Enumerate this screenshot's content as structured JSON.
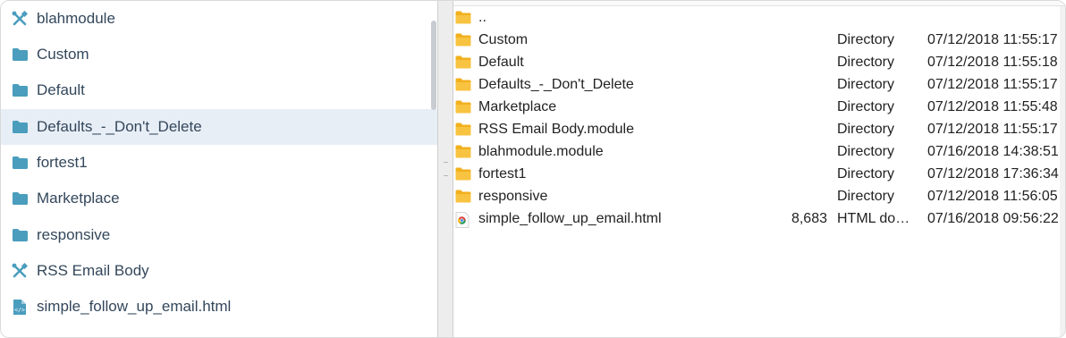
{
  "left_panel": {
    "items": [
      {
        "label": "blahmodule",
        "icon": "module-tools-icon"
      },
      {
        "label": "Custom",
        "icon": "folder-icon"
      },
      {
        "label": "Default",
        "icon": "folder-icon"
      },
      {
        "label": "Defaults_-_Don't_Delete",
        "icon": "folder-icon",
        "selected": true
      },
      {
        "label": "fortest1",
        "icon": "folder-icon"
      },
      {
        "label": "Marketplace",
        "icon": "folder-icon"
      },
      {
        "label": "responsive",
        "icon": "folder-icon"
      },
      {
        "label": "RSS Email Body",
        "icon": "module-tools-icon"
      },
      {
        "label": "simple_follow_up_email.html",
        "icon": "html-file-icon"
      }
    ]
  },
  "file_list": {
    "rows": [
      {
        "name": "..",
        "size": "",
        "kind": "",
        "date": "",
        "icon": "folder-icon"
      },
      {
        "name": "Custom",
        "size": "",
        "kind": "Directory",
        "date": "07/12/2018 11:55:17",
        "icon": "folder-icon"
      },
      {
        "name": "Default",
        "size": "",
        "kind": "Directory",
        "date": "07/12/2018 11:55:18",
        "icon": "folder-icon"
      },
      {
        "name": "Defaults_-_Don't_Delete",
        "size": "",
        "kind": "Directory",
        "date": "07/12/2018 11:55:17",
        "icon": "folder-icon"
      },
      {
        "name": "Marketplace",
        "size": "",
        "kind": "Directory",
        "date": "07/12/2018 11:55:48",
        "icon": "folder-icon"
      },
      {
        "name": "RSS Email Body.module",
        "size": "",
        "kind": "Directory",
        "date": "07/12/2018 11:55:17",
        "icon": "folder-icon"
      },
      {
        "name": "blahmodule.module",
        "size": "",
        "kind": "Directory",
        "date": "07/16/2018 14:38:51",
        "icon": "folder-icon"
      },
      {
        "name": "fortest1",
        "size": "",
        "kind": "Directory",
        "date": "07/12/2018 17:36:34",
        "icon": "folder-icon"
      },
      {
        "name": "responsive",
        "size": "",
        "kind": "Directory",
        "date": "07/12/2018 11:56:05",
        "icon": "folder-icon"
      },
      {
        "name": "simple_follow_up_email.html",
        "size": "8,683",
        "kind": "HTML do…",
        "date": "07/16/2018 09:56:22",
        "icon": "chrome-html-icon"
      }
    ]
  },
  "colors": {
    "left_icon": "#4a9dbd",
    "selected_row": "#e8eef6",
    "folder": "#f2b01e"
  }
}
